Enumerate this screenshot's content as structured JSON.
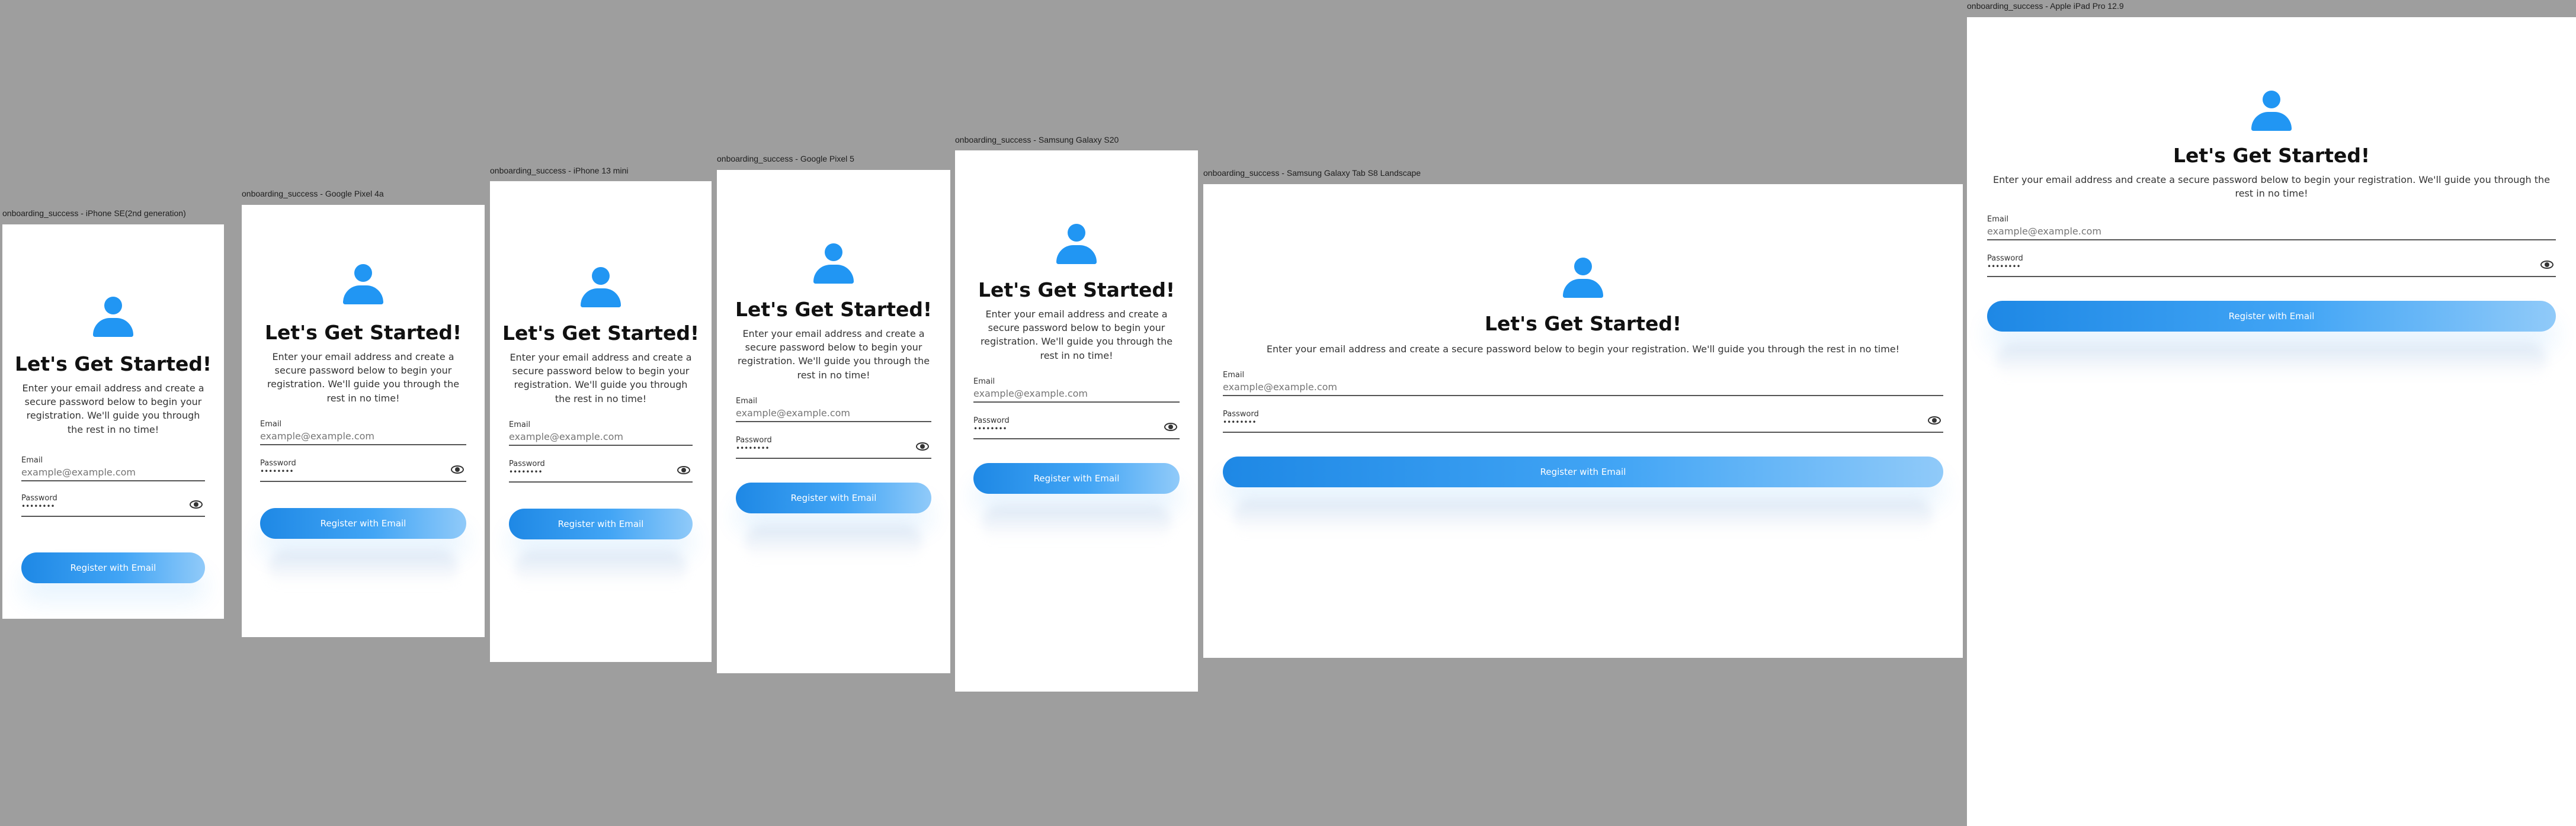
{
  "frames": [
    {
      "label": "onboarding_success - iPhone SE(2nd generation)"
    },
    {
      "label": "onboarding_success - Google Pixel 4a"
    },
    {
      "label": "onboarding_success - iPhone 13 mini"
    },
    {
      "label": "onboarding_success - Google Pixel 5"
    },
    {
      "label": "onboarding_success - Samsung Galaxy S20"
    },
    {
      "label": "onboarding_success - Samsung Galaxy Tab S8 Landscape"
    },
    {
      "label": "onboarding_success - Apple iPad Pro 12.9"
    }
  ],
  "screen": {
    "title": "Let's Get Started!",
    "description": "Enter your email address and create a secure password below to begin your registration. We'll guide you through the rest in no time!",
    "email_label": "Email",
    "email_placeholder": "example@example.com",
    "password_label": "Password",
    "password_value": "••••••••",
    "register_button": "Register with Email",
    "icons": {
      "avatar": "person-icon",
      "eye": "eye-icon"
    },
    "colors": {
      "accent": "#2196f3",
      "background": "#9e9e9e",
      "card": "#ffffff"
    }
  }
}
